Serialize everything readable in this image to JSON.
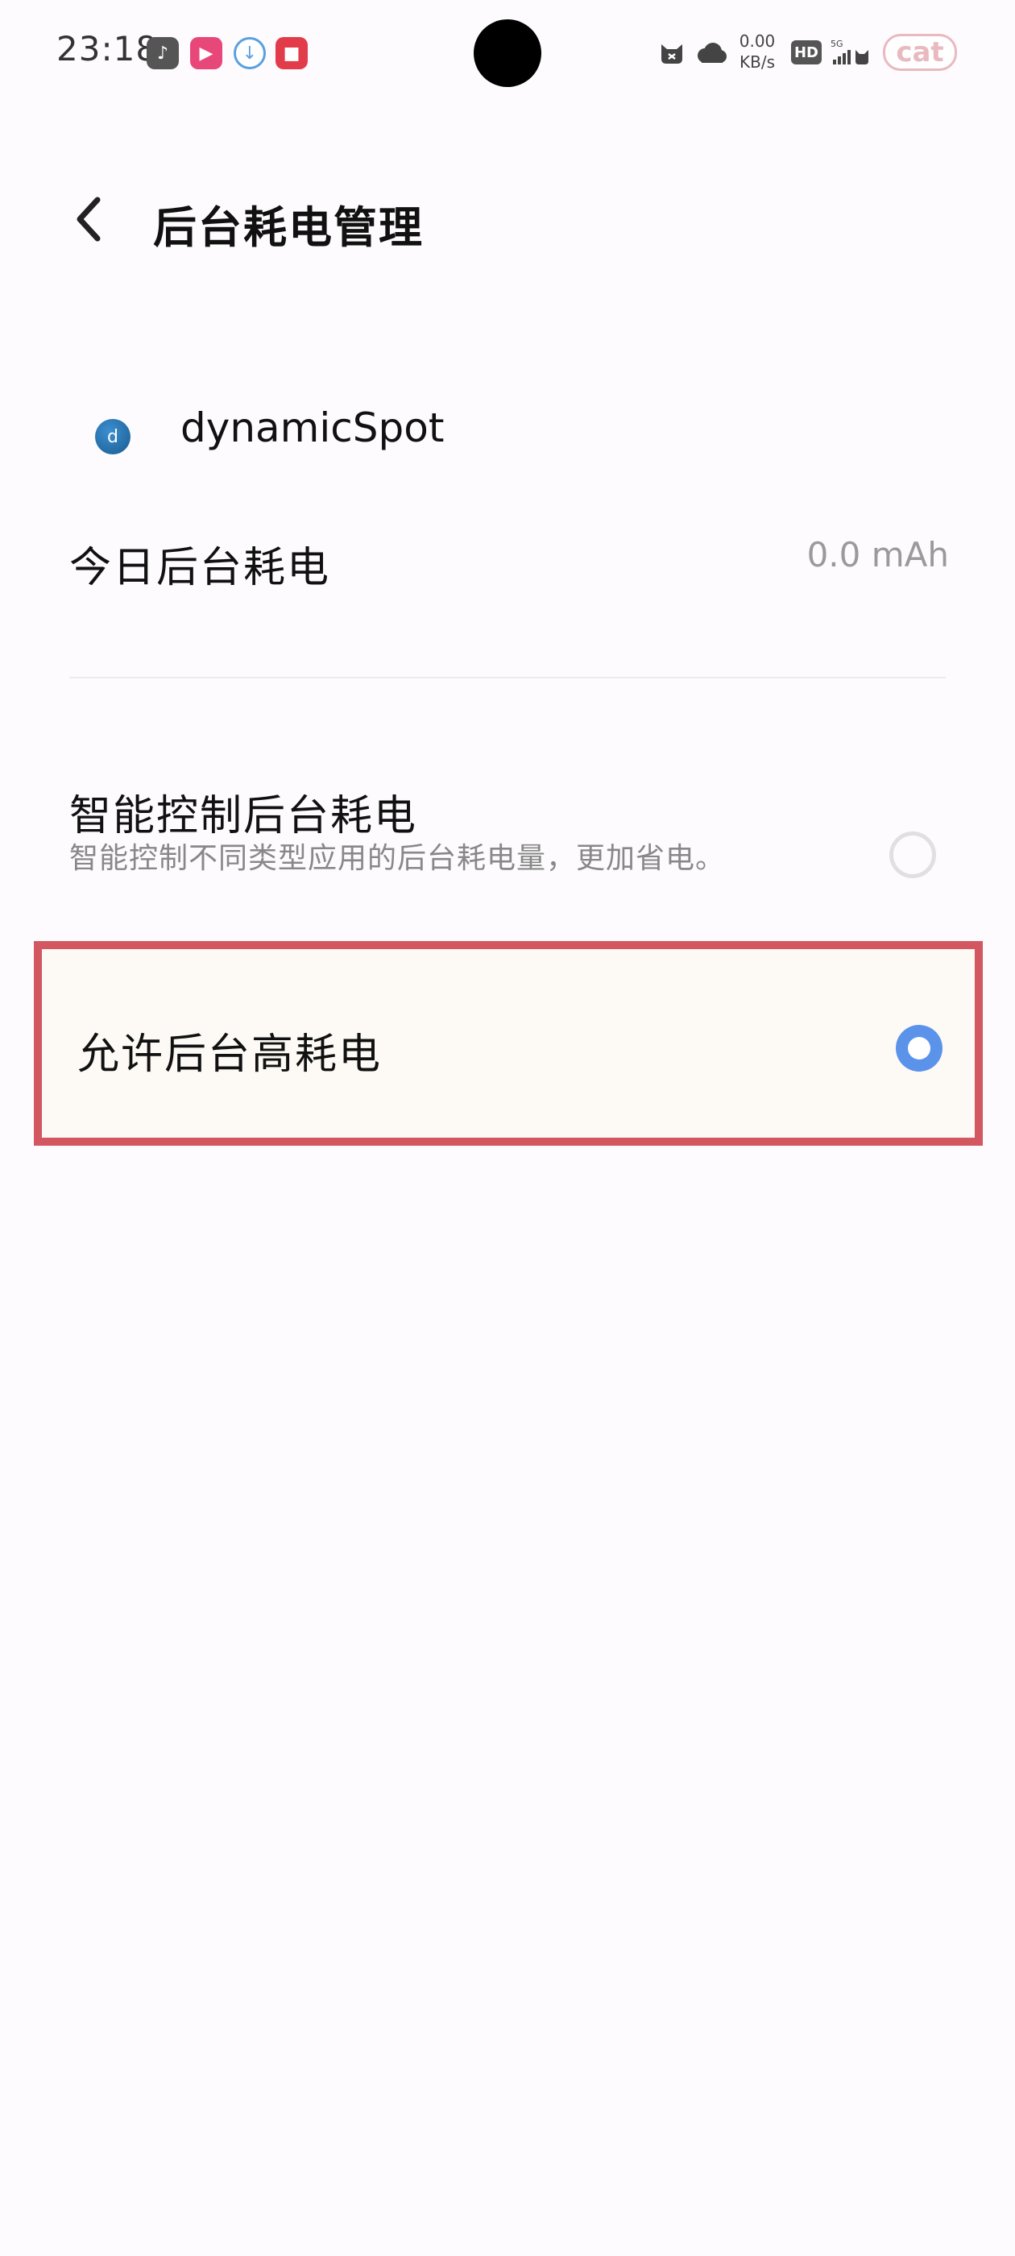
{
  "status_bar": {
    "time": "23:18",
    "net_speed_value": "0.00",
    "net_speed_unit": "KB/s",
    "hd_label": "HD",
    "network_label": "5G",
    "battery_label": "cat",
    "notification_icons": [
      "music-app-icon",
      "video-app-icon",
      "download-icon",
      "red-app-icon"
    ]
  },
  "header": {
    "title": "后台耗电管理"
  },
  "app": {
    "name": "dynamicSpot",
    "icon": "d"
  },
  "usage": {
    "label": "今日后台耗电",
    "value": "0.0 mAh"
  },
  "options": [
    {
      "title": "智能控制后台耗电",
      "description": "智能控制不同类型应用的后台耗电量，更加省电。",
      "selected": false
    },
    {
      "title": "允许后台高耗电",
      "selected": true
    }
  ],
  "colors": {
    "accent": "#5b93ea",
    "highlight_border": "#d35760",
    "background": "#fdfbfd"
  }
}
